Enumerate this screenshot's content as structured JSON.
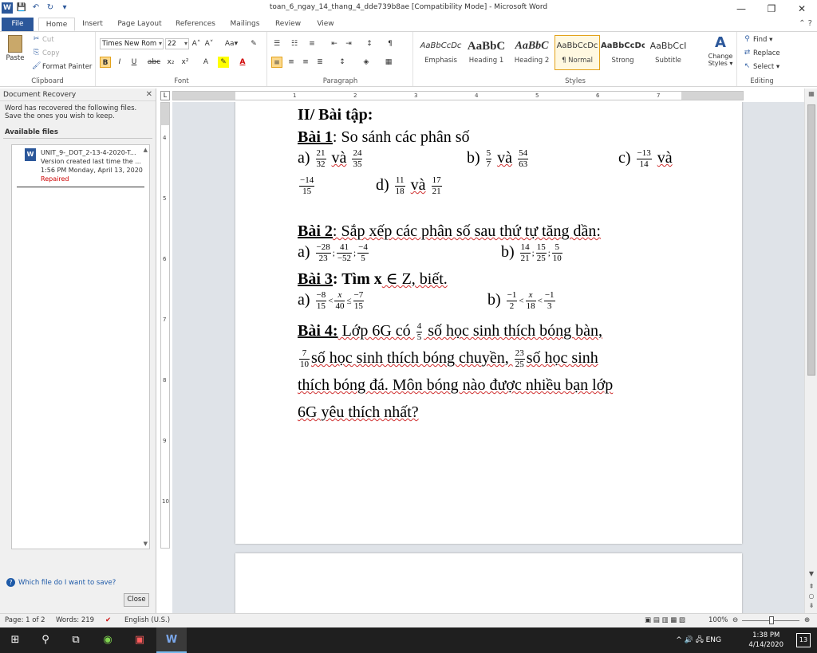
{
  "window": {
    "title": "toan_6_ngay_14_thang_4_dde739b8ae [Compatibility Mode] - Microsoft Word",
    "minimize": "—",
    "restore": "❐",
    "close": "✕"
  },
  "quick_access": {
    "app_icon": "W",
    "save": "💾",
    "undo": "↶",
    "redo": "↻",
    "customize": "▾"
  },
  "tabs": [
    "File",
    "Home",
    "Insert",
    "Page Layout",
    "References",
    "Mailings",
    "Review",
    "View"
  ],
  "help_icons": "⌃  ?",
  "ribbon": {
    "clipboard": {
      "label": "Clipboard",
      "paste": "Paste",
      "cut": "Cut",
      "copy": "Copy",
      "format_painter": "Format Painter"
    },
    "font": {
      "label": "Font",
      "family": "Times New Rom",
      "size": "22",
      "bold": "B",
      "italic": "I",
      "underline": "U",
      "strike": "abc",
      "subscript": "x₂",
      "superscript": "x²",
      "grow": "A˄",
      "shrink": "A˅",
      "case": "Aa▾",
      "clear": "✎"
    },
    "paragraph": {
      "label": "Paragraph"
    },
    "styles": {
      "label": "Styles",
      "items": [
        {
          "sample": "AaBbCcDc",
          "name": "Emphasis"
        },
        {
          "sample": "AaBbC",
          "name": "Heading 1"
        },
        {
          "sample": "AaBbC",
          "name": "Heading 2"
        },
        {
          "sample": "AaBbCcDc",
          "name": "¶ Normal"
        },
        {
          "sample": "AaBbCcDc",
          "name": "Strong"
        },
        {
          "sample": "AaBbCcI",
          "name": "Subtitle"
        }
      ],
      "change_styles": "Change Styles ▾"
    },
    "editing": {
      "label": "Editing",
      "find": "Find ▾",
      "replace": "Replace",
      "select": "Select ▾"
    }
  },
  "recovery": {
    "title": "Document Recovery",
    "message": "Word has recovered the following files.  Save the ones you wish to keep.",
    "available": "Available files",
    "file": {
      "name": "UNIT_9-_DOT_2-13-4-2020-T...",
      "line2": "Version created last time the ...",
      "line3": "1:56 PM Monday, April 13, 2020",
      "status": "Repaired"
    },
    "help_link": "Which file do I want to save?",
    "close_label": "Close"
  },
  "document": {
    "section_heading": "II/ Bài tập:",
    "bai1_title": "Bài 1",
    "bai1_text": ": So sánh các phân số",
    "bai1": {
      "a_label": "a)",
      "a_f1": [
        "21",
        "32"
      ],
      "a_f2": [
        "24",
        "35"
      ],
      "b_label": "b)",
      "b_f1": [
        "5",
        "7"
      ],
      "b_f2": [
        "54",
        "63"
      ],
      "c_label": "c)",
      "c_f1": [
        "−13",
        "14"
      ],
      "c_f2": [
        "−14",
        "15"
      ],
      "d_label": "d)",
      "d_f1": [
        "11",
        "18"
      ],
      "d_f2": [
        "17",
        "21"
      ],
      "and": "và"
    },
    "bai2_title": "Bài 2",
    "bai2_text": ": Sắp xếp các phân số sau thứ tự tăng dần:",
    "bai2": {
      "a_label": "a)",
      "a_fracs": [
        [
          "−28",
          "23"
        ],
        [
          "41",
          "−52"
        ],
        [
          "−4",
          "5"
        ]
      ],
      "b_label": "b)",
      "b_fracs": [
        [
          "14",
          "21"
        ],
        [
          "15",
          "25"
        ],
        [
          "5",
          "10"
        ]
      ],
      "sep": ";"
    },
    "bai3_title": "Bài 3",
    "bai3_text_bold": ": Tìm x",
    "bai3_text_rest": " ∈ Z, biết.",
    "bai3": {
      "a_label": "a)",
      "a_f1": [
        "−8",
        "15"
      ],
      "a_f2": [
        "x",
        "40"
      ],
      "a_f3": [
        "−7",
        "15"
      ],
      "a_rel1": "<",
      "a_rel2": "≤",
      "b_label": "b)",
      "b_f1": [
        "−1",
        "2"
      ],
      "b_f2": [
        "x",
        "18"
      ],
      "b_f3": [
        "−1",
        "3"
      ],
      "b_rel1": "<",
      "b_rel2": "<"
    },
    "bai4_title": "Bài 4:",
    "bai4": {
      "t1": " Lớp 6G có ",
      "f1": [
        "4",
        "5"
      ],
      "t2": " số học sinh thích bóng bàn,",
      "f2": [
        "7",
        "10"
      ],
      "t3": "số học sinh thích bóng chuyền, ",
      "f3": [
        "23",
        "25"
      ],
      "t4": "số học sinh",
      "t5": "thích bóng đá. Môn bóng nào được nhiều bạn lớp",
      "t6": "6G yêu thích nhất?"
    }
  },
  "status": {
    "page": "Page: 1 of 2",
    "words": "Words: 219",
    "language": "English (U.S.)",
    "zoom": "100%"
  },
  "taskbar": {
    "tray": "^  🔊  🖧  ENG",
    "time": "1:38 PM",
    "date": "4/14/2020",
    "notifications": "13"
  }
}
